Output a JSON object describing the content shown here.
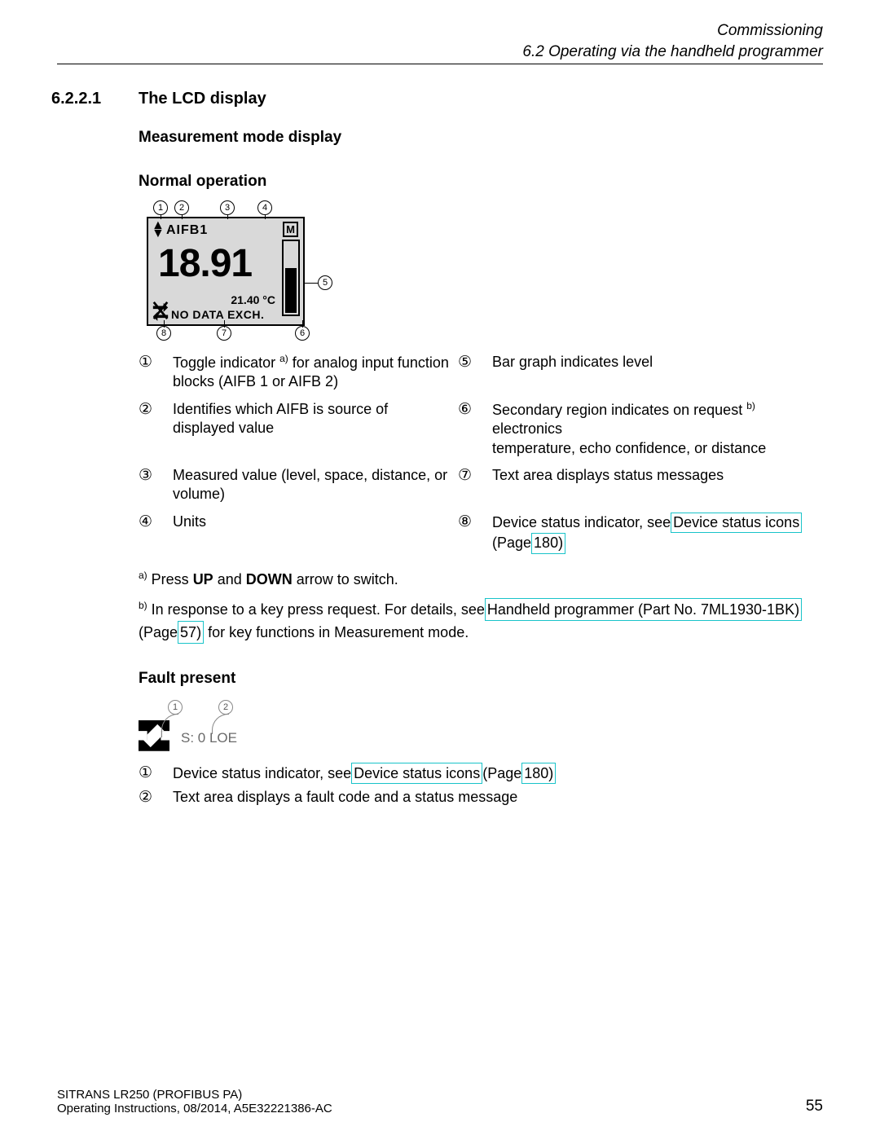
{
  "header": {
    "chapter": "Commissioning",
    "section": "6.2 Operating via the handheld programmer"
  },
  "section": {
    "number": "6.2.2.1",
    "title": "The LCD display"
  },
  "h": {
    "measurement": "Measurement mode display",
    "normal": "Normal operation",
    "fault": "Fault present"
  },
  "lcd": {
    "aifb": "AIFB1",
    "unit_box": "M",
    "value": "18.91",
    "temp": "21.40 °C",
    "msg": "NO DATA EXCH."
  },
  "callouts": {
    "n1": "1",
    "n2": "2",
    "n3": "3",
    "n4": "4",
    "n5": "5",
    "n6": "6",
    "n7": "7",
    "n8": "8"
  },
  "legend": {
    "r1a": "Toggle indicator ",
    "r1sup": "a)",
    "r1b": " for analog input function blocks (AIFB 1 or AIFB 2)",
    "r2": "Identifies which AIFB is source of displayed value",
    "r3": "Measured value (level, space, distance, or volume)",
    "r4": "Units",
    "r5": "Bar graph indicates level",
    "r6a": "Secondary region indicates on request ",
    "r6sup": "b)",
    "r6b": " electronics",
    "r6c": "temperature, echo confidence, or distance",
    "r7": "Text area displays status messages",
    "r8a": "Device status indicator, see",
    "r8link": " Device status icons ",
    "r8b": "(Page",
    "r8page": " 180)",
    "b1": "①",
    "b2": "②",
    "b3": "③",
    "b4": "④",
    "b5": "⑤",
    "b6": "⑥",
    "b7": "⑦",
    "b8": "⑧"
  },
  "note_a": {
    "sup": "a)",
    "t1": " Press ",
    "up": "UP",
    "t2": " and ",
    "down": "DOWN",
    "t3": " arrow to switch."
  },
  "note_b": {
    "sup": "b)",
    "t1": " In response to a key press request. For details, see",
    "link": " Handheld programmer (Part No. 7ML1930-1BK) ",
    "t2": "(Page",
    "page": " 57)",
    "t3": " for key functions in Measurement mode."
  },
  "fault": {
    "text": "S: 0 LOE",
    "c1": "1",
    "c2": "2",
    "row1a": "Device status indicator, see",
    "row1link": " Device status icons ",
    "row1b": "(Page",
    "row1page": " 180)",
    "row2": "Text area displays a fault code and a status message"
  },
  "footer": {
    "l1": "SITRANS LR250 (PROFIBUS PA)",
    "l2": "Operating Instructions, 08/2014, A5E32221386-AC",
    "page": "55"
  }
}
